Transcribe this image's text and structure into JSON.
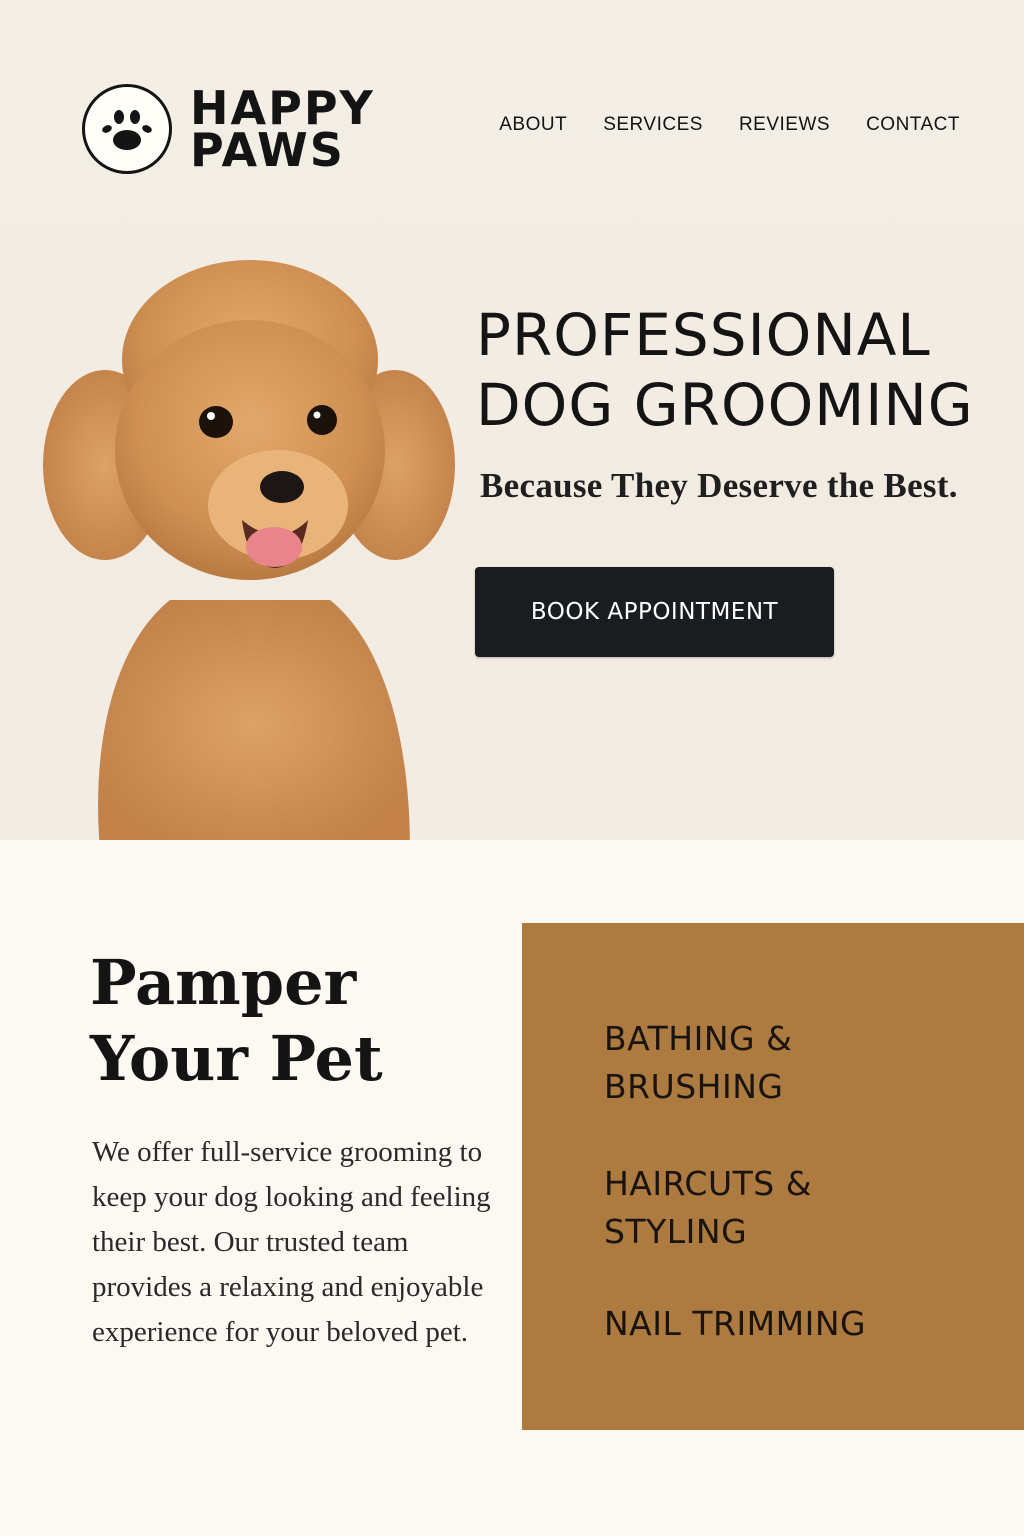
{
  "brand": {
    "line1": "HAPPY",
    "line2": "PAWS"
  },
  "nav": {
    "items": [
      "ABOUT",
      "SERVICES",
      "REVIEWS",
      "CONTACT"
    ]
  },
  "hero": {
    "headline_line1": "PROFESSIONAL",
    "headline_line2": "DOG GROOMING",
    "tagline": "Because They Deserve the Best.",
    "cta_label": "BOOK APPOINTMENT"
  },
  "about": {
    "title_line1": "Pamper",
    "title_line2": "Your Pet",
    "description": "We offer full-service grooming to keep your dog looking and feeling their best. Our trusted team provides a relaxing and enjoyable experience for your beloved pet."
  },
  "services": [
    {
      "line1": "BATHING &",
      "line2": "BRUSHING"
    },
    {
      "line1": "HAIRCUTS &",
      "line2": "STYLING"
    },
    {
      "line1": "NAIL TRIMMING",
      "line2": ""
    }
  ],
  "colors": {
    "accent": "#ad7a40",
    "button": "#1a1d1f",
    "background": "#fcf9f3"
  },
  "icons": {
    "logo": "paw-print-icon"
  }
}
